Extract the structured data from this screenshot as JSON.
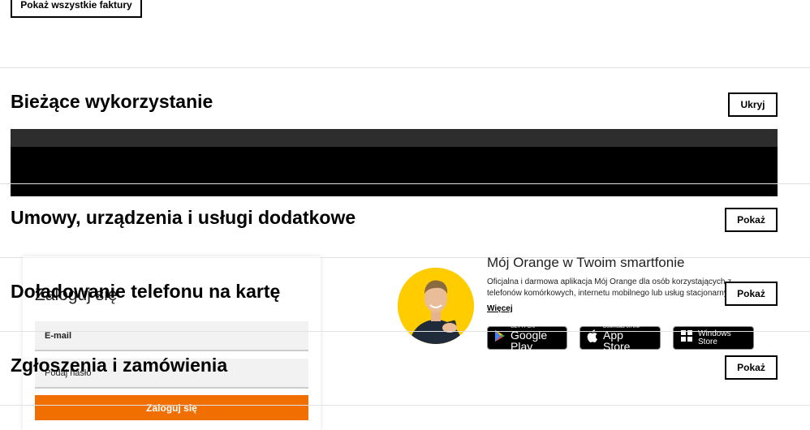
{
  "invoices": {
    "show_all_label": "Pokaż wszystkie faktury"
  },
  "sections": [
    {
      "title": "Bieżące wykorzystanie",
      "button": "Ukryj"
    },
    {
      "title": "Umowy, urządzenia i usługi dodatkowe",
      "button": "Pokaż"
    },
    {
      "title": "Doładowanie telefonu na kartę",
      "button": "Pokaż"
    },
    {
      "title": "Zgłoszenia i zamówienia",
      "button": "Pokaż"
    }
  ],
  "login": {
    "title": "Zaloguj się",
    "email_placeholder": "E-mail",
    "password_placeholder": "Podaj hasło",
    "submit_label": "Zaloguj się"
  },
  "promo": {
    "title": "Mój Orange w Twoim smartfonie",
    "description": "Oficjalna i darmowa aplikacja Mój Orange dla osób korzystających z telefonów komórkowych, internetu mobilnego lub usług stacjonarnych",
    "more_link": "Więcej",
    "stores": [
      {
        "small": "GET IT ON",
        "big": "Google Play",
        "icon": "google-play-icon"
      },
      {
        "small": "Download on the",
        "big": "App Store",
        "icon": "apple-icon"
      },
      {
        "small": "Windows",
        "big": "Store",
        "icon": "windows-icon"
      }
    ]
  },
  "colors": {
    "accent": "#f16e00",
    "avatar_bg": "#ffcc00",
    "usage_bar": "#000000"
  }
}
